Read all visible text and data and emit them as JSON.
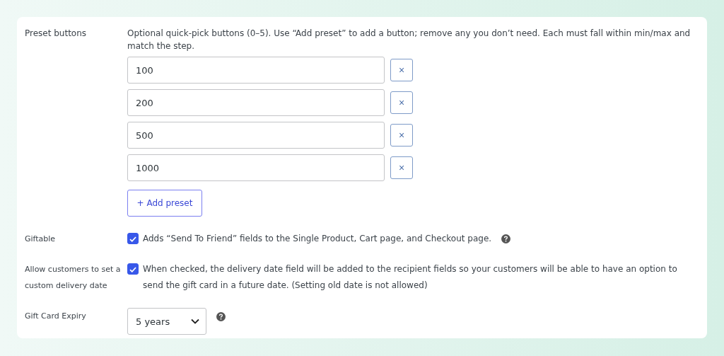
{
  "settings": [
    {
      "kind": "presets",
      "label": "Preset buttons",
      "description": "Optional quick-pick buttons (0–5). Use “Add preset” to add a button; remove any you don’t need. Each must fall within min/max and match the step.",
      "presets": [
        {
          "value": "100",
          "remove": "×"
        },
        {
          "value": "200",
          "remove": "×"
        },
        {
          "value": "500",
          "remove": "×"
        },
        {
          "value": "1000",
          "remove": "×"
        }
      ],
      "add_button": "+ Add preset"
    },
    {
      "kind": "checkbox",
      "label": "Giftable",
      "checked": true,
      "text": "Adds “Send To Friend” fields to the Single Product, Cart page, and Checkout page.",
      "help": true
    },
    {
      "kind": "checkbox",
      "label": "Allow customers to set a custom delivery date",
      "checked": true,
      "text": "When checked, the delivery date field will be added to the recipient fields so your customers will be able to have an option to send the gift card in a future date. (Setting old date is not allowed)",
      "help": false
    },
    {
      "kind": "select",
      "label": "Gift Card Expiry",
      "value": "5 years",
      "help": true
    }
  ]
}
